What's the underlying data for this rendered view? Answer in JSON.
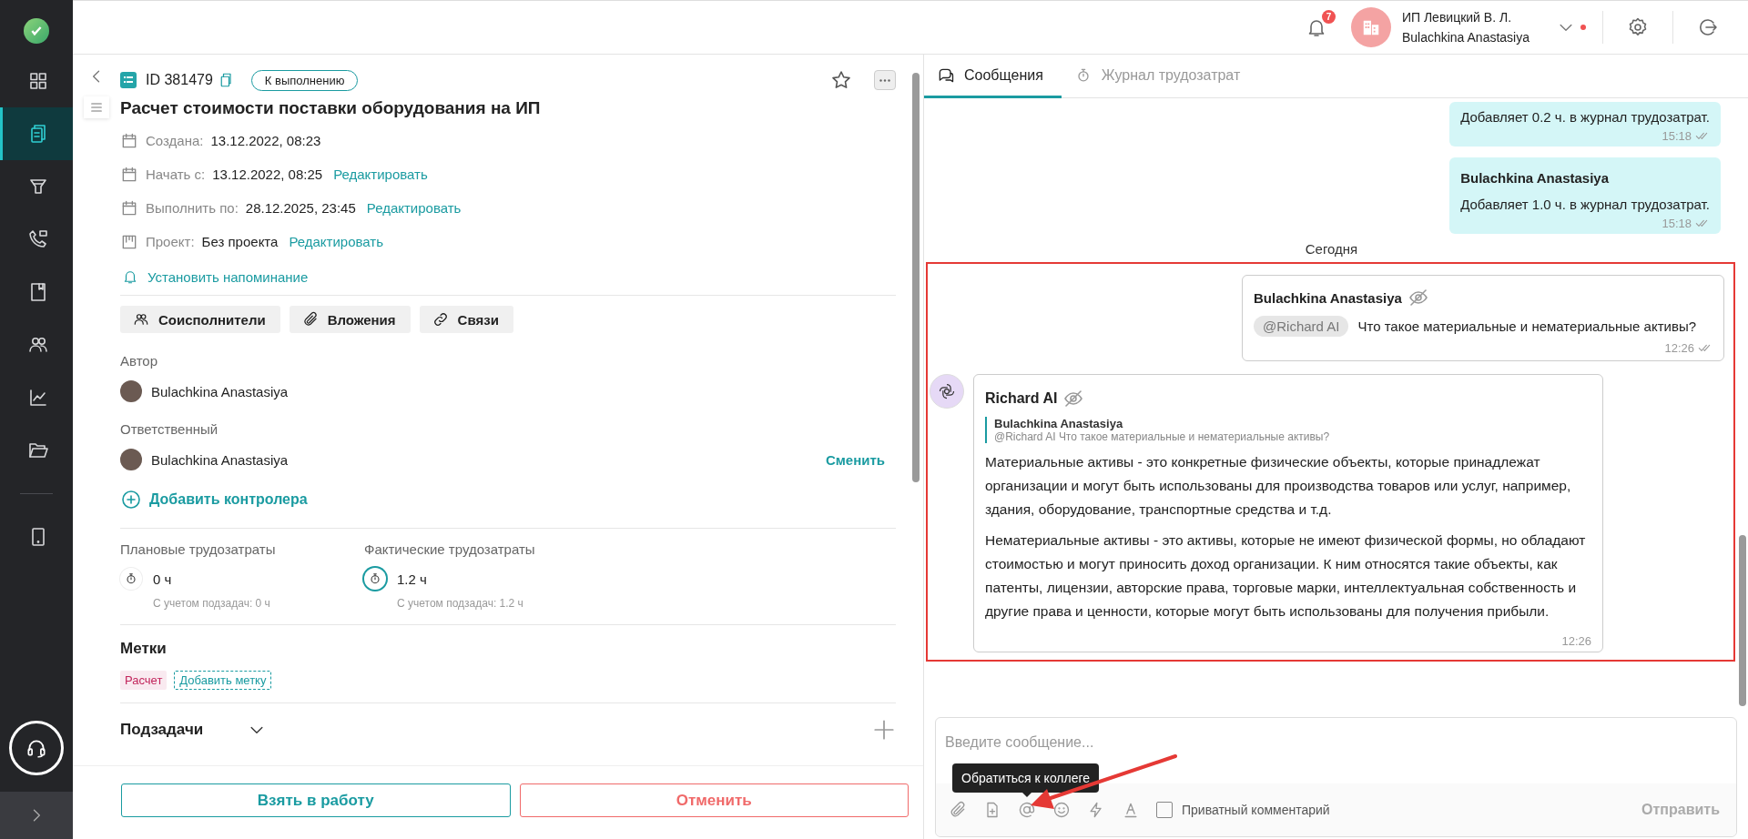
{
  "sidebar": {
    "items": [
      {
        "selected": false
      },
      {
        "selected": true
      },
      {
        "selected": false
      },
      {
        "selected": false
      },
      {
        "selected": false
      },
      {
        "selected": false
      },
      {
        "selected": false
      },
      {
        "selected": false
      },
      {
        "selected": false
      }
    ]
  },
  "header": {
    "notifications": {
      "count": "7"
    },
    "account": {
      "company": "ИП Левицкий В. Л.",
      "user": "Bulachkina Anastasiya"
    }
  },
  "task": {
    "id": "ID 381479",
    "status": "К выполнению",
    "title": "Расчет стоимости поставки оборудования на ИП",
    "favorite": false,
    "fields": [
      {
        "kind": "date",
        "label": "Создана:",
        "value": "13.12.2022, 08:23"
      },
      {
        "kind": "date",
        "label": "Начать с:",
        "value": "13.12.2022, 08:25",
        "action": "Редактировать"
      },
      {
        "kind": "date",
        "label": "Выполнить по:",
        "value": "28.12.2025, 23:45",
        "action": "Редактировать"
      },
      {
        "kind": "project",
        "label": "Проект:",
        "value": "Без проекта",
        "action": "Редактировать"
      }
    ],
    "reminder": "Установить напоминание",
    "sections": [
      "Соисполнители",
      "Вложения",
      "Связи"
    ],
    "author": {
      "label": "Автор",
      "name": "Bulachkina Anastasiya"
    },
    "responsible": {
      "label": "Ответственный",
      "name": "Bulachkina Anastasiya",
      "action": "Сменить"
    },
    "add_controller": "Добавить контролера",
    "efforts": [
      {
        "label": "Плановые трудозатраты",
        "value": "0 ч",
        "note": "С учетом подзадач: 0 ч",
        "active": false
      },
      {
        "label": "Фактические трудозатраты",
        "value": "1.2 ч",
        "note": "С учетом подзадач: 1.2 ч",
        "active": true
      }
    ],
    "tags": {
      "title": "Метки",
      "items": [
        {
          "label": "Расчет",
          "color": "#c2255c"
        }
      ],
      "add": "Добавить метку"
    },
    "subtasks": {
      "title": "Подзадачи",
      "expanded": false
    },
    "actions": [
      {
        "label": "Взять в работу",
        "kind": "primary"
      },
      {
        "label": "Отменить",
        "kind": "danger"
      }
    ]
  },
  "chat": {
    "tabs": [
      {
        "label": "Сообщения",
        "selected": true
      },
      {
        "label": "Журнал трудозатрат",
        "selected": false
      }
    ],
    "messages": [
      {
        "kind": "system",
        "text": "Добавляет 0.2 ч. в журнал трудозатрат.",
        "time": "15:18",
        "highlighted": false
      },
      {
        "kind": "system",
        "author": "Bulachkina Anastasiya",
        "text": "Добавляет 1.0 ч. в журнал трудозатрат.",
        "time": "15:18",
        "highlighted": false
      },
      {
        "kind": "divider",
        "text": "Сегодня",
        "highlighted": false
      },
      {
        "kind": "outgoing",
        "author": "Bulachkina Anastasiya",
        "private": true,
        "mention": "@Richard AI",
        "text": "Что такое материальные и нематериальные активы?",
        "time": "12:26",
        "highlighted": true
      },
      {
        "kind": "incoming",
        "author": "Richard AI",
        "private": true,
        "quote": {
          "author": "Bulachkina Anastasiya",
          "text": "@Richard AI Что такое материальные и нематериальные активы?"
        },
        "paragraphs": [
          "Материальные активы - это конкретные физические объекты, которые принадлежат организации и могут быть использованы для производства товаров или услуг, например, здания, оборудование, транспортные средства и т.д.",
          "Нематериальные активы - это активы, которые не имеют физической формы, но обладают стоимостью и могут приносить доход организации. К ним относятся такие объекты, как патенты, лицензии, авторские права, торговые марки, интеллектуальная собственность и другие права и ценности, которые могут быть использованы для получения прибыли."
        ],
        "time": "12:26",
        "highlighted": true
      }
    ],
    "composer": {
      "placeholder": "Введите сообщение...",
      "tooltip": "Обратиться к коллеге",
      "private": {
        "label": "Приватный комментарий",
        "checked": false
      },
      "send": {
        "label": "Отправить",
        "disabled": true
      }
    }
  }
}
